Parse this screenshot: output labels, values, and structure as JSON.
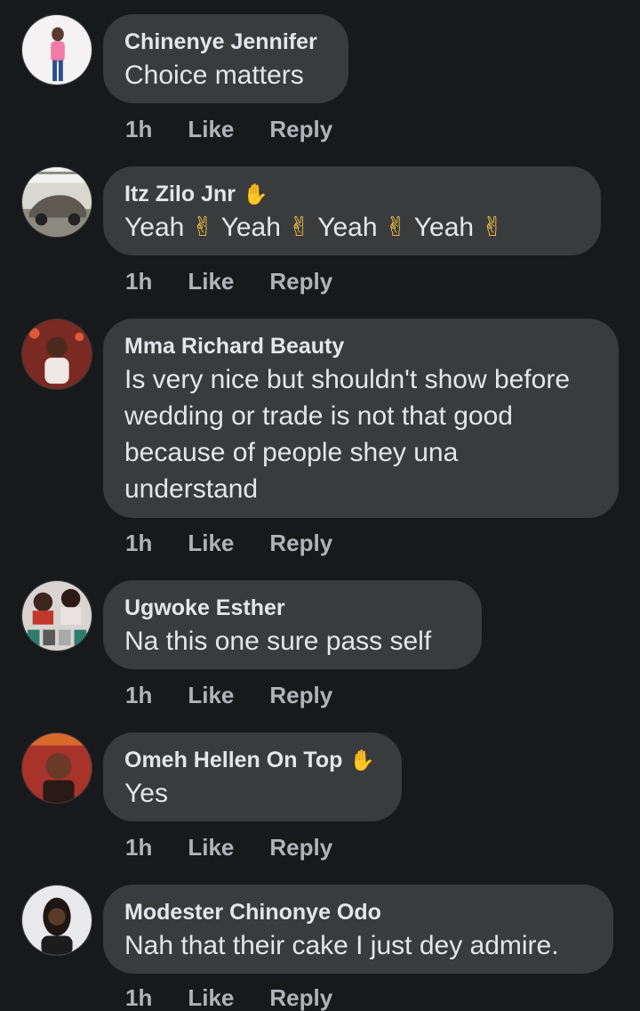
{
  "comments": [
    {
      "author": "Chinenye Jennifer",
      "badge": "",
      "text": "Choice matters",
      "time": "1h",
      "like": "Like",
      "reply": "Reply"
    },
    {
      "author": "Itz Zilo Jnr",
      "badge": "wave-icon",
      "text_parts": [
        "Yeah",
        "Yeah",
        "Yeah",
        "Yeah"
      ],
      "time": "1h",
      "like": "Like",
      "reply": "Reply"
    },
    {
      "author": "Mma Richard Beauty",
      "badge": "",
      "text": "Is very nice but shouldn't show before wedding or trade is not that good because of people shey una understand",
      "time": "1h",
      "like": "Like",
      "reply": "Reply"
    },
    {
      "author": "Ugwoke Esther",
      "badge": "",
      "text": "Na this one sure pass self",
      "time": "1h",
      "like": "Like",
      "reply": "Reply"
    },
    {
      "author": "Omeh Hellen On Top",
      "badge": "wave-icon",
      "text": "Yes",
      "time": "1h",
      "like": "Like",
      "reply": "Reply"
    },
    {
      "author": "Modester Chinonye Odo",
      "badge": "",
      "text": "Nah that their cake I just dey admire.",
      "time": "1h",
      "like": "Like",
      "reply": "Reply"
    }
  ],
  "colors": {
    "background": "#18191a",
    "bubble": "#3a3b3c",
    "text": "#e4e6eb",
    "meta": "#b0b3b8"
  }
}
